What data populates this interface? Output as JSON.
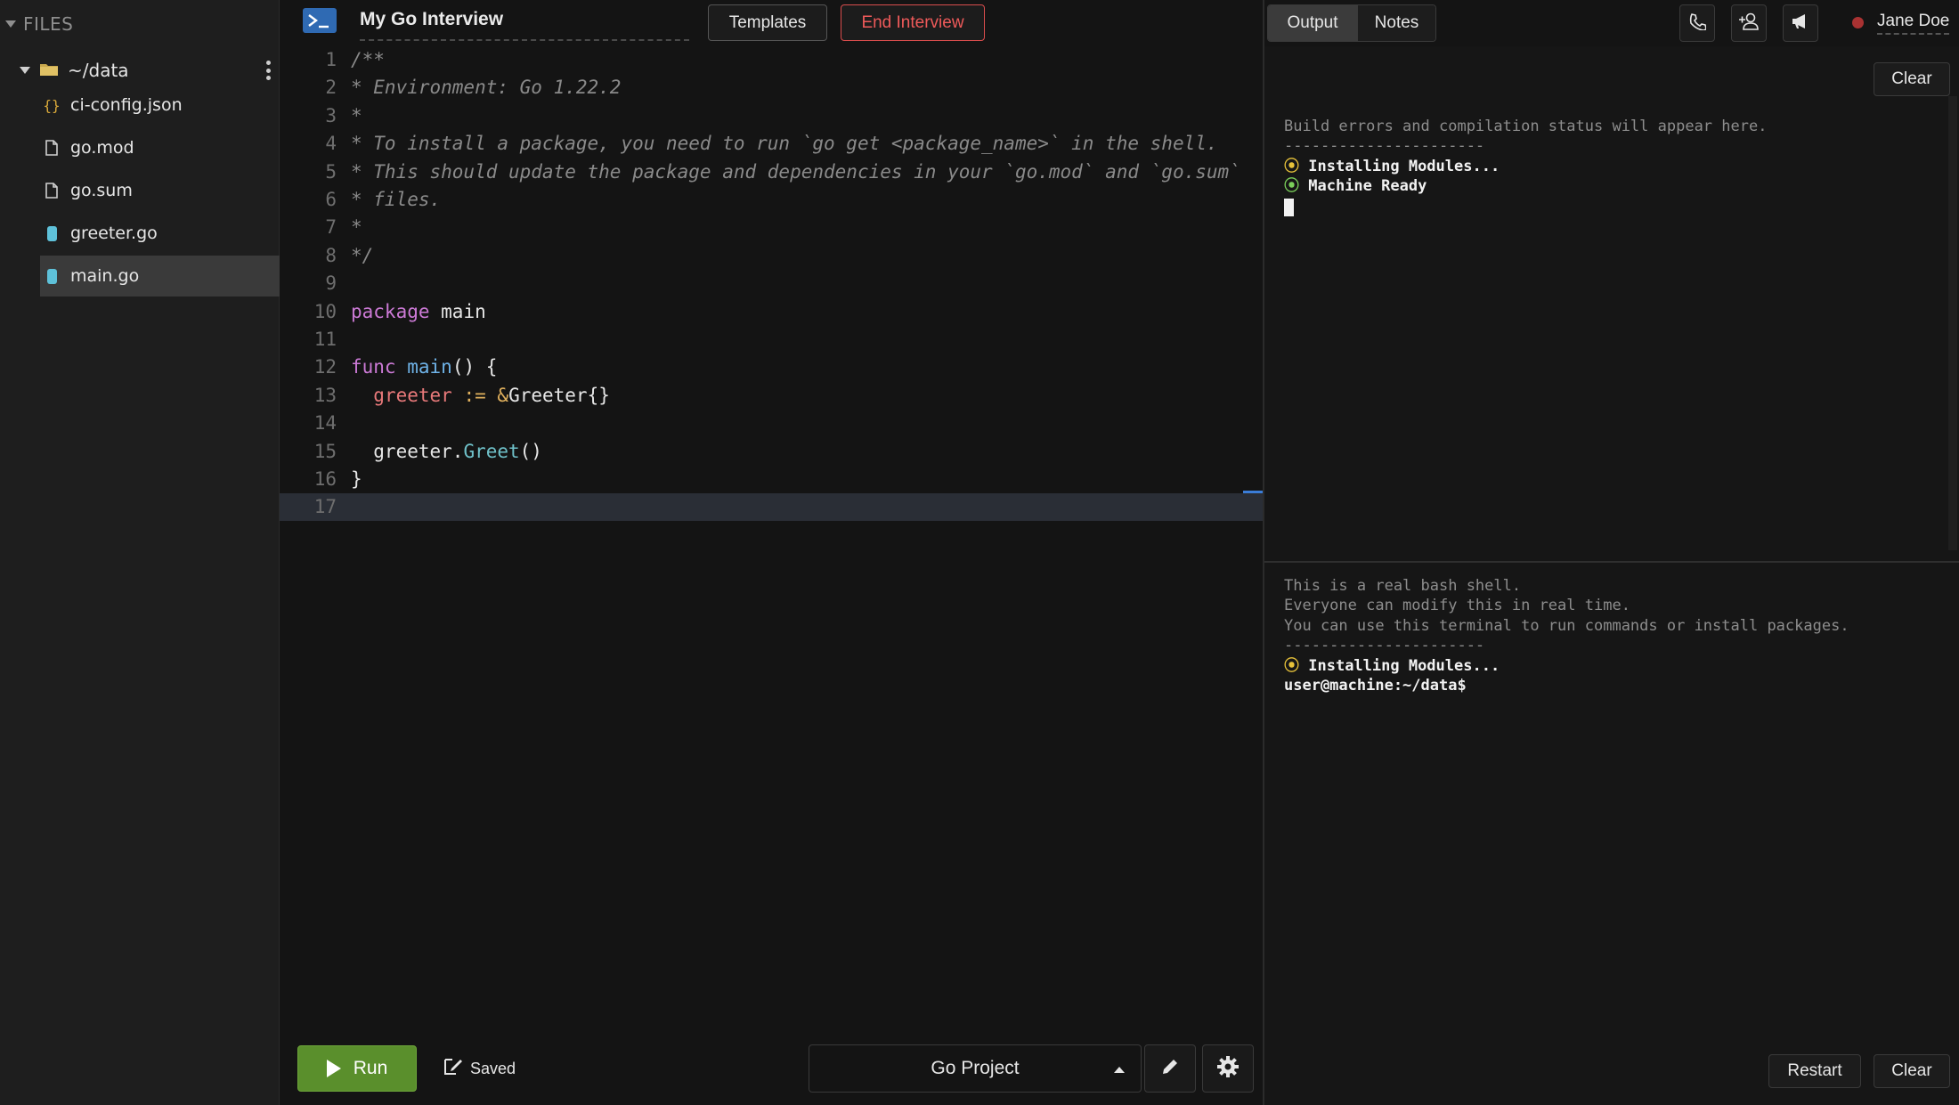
{
  "sidebar": {
    "header": "FILES",
    "folder": "~/data",
    "files": [
      {
        "name": "ci-config.json",
        "icon": "json-braces-icon"
      },
      {
        "name": "go.mod",
        "icon": "file-icon"
      },
      {
        "name": "go.sum",
        "icon": "file-icon"
      },
      {
        "name": "greeter.go",
        "icon": "go-file-icon"
      },
      {
        "name": "main.go",
        "icon": "go-file-icon",
        "active": true
      }
    ]
  },
  "header": {
    "title": "My Go Interview",
    "templates_label": "Templates",
    "end_label": "End Interview"
  },
  "editor": {
    "line_numbers": [
      "1",
      "2",
      "3",
      "4",
      "5",
      "6",
      "7",
      "8",
      "9",
      "10",
      "11",
      "12",
      "13",
      "14",
      "15",
      "16",
      "17"
    ],
    "lines": [
      "/**",
      "* Environment: Go 1.22.2",
      "*",
      "* To install a package, you need to run `go get <package_name>` in the shell.",
      "* This should update the package and dependencies in your `go.mod` and `go.sum`",
      "* files.",
      "*",
      "*/",
      "",
      "package main",
      "",
      "func main() {",
      "  greeter := &Greeter{}",
      "",
      "  greeter.Greet()",
      "}",
      ""
    ],
    "current_line": 17
  },
  "bottom": {
    "run_label": "Run",
    "saved_label": "Saved",
    "project_select": "Go Project"
  },
  "right": {
    "tabs": [
      "Output",
      "Notes"
    ],
    "active_tab": "Output",
    "user_name": "Jane Doe",
    "status_color": "#a93232",
    "output_clear": "Clear",
    "output": {
      "intro": "Build errors and compilation status will appear here.",
      "separator": "----------------------",
      "status1": "Installing Modules...",
      "status2": "Machine Ready"
    },
    "shell": {
      "line1": "This is a real bash shell.",
      "line2": "Everyone can modify this in real time.",
      "line3": "You can use this terminal to run commands or install packages.",
      "separator": "----------------------",
      "status": "Installing Modules...",
      "prompt": "user@machine:~/data$"
    },
    "restart_label": "Restart",
    "shell_clear": "Clear"
  },
  "colors": {
    "run_green": "#5a8f2c",
    "end_red": "#ef5a5a",
    "accent_blue": "#2f6ab3"
  }
}
